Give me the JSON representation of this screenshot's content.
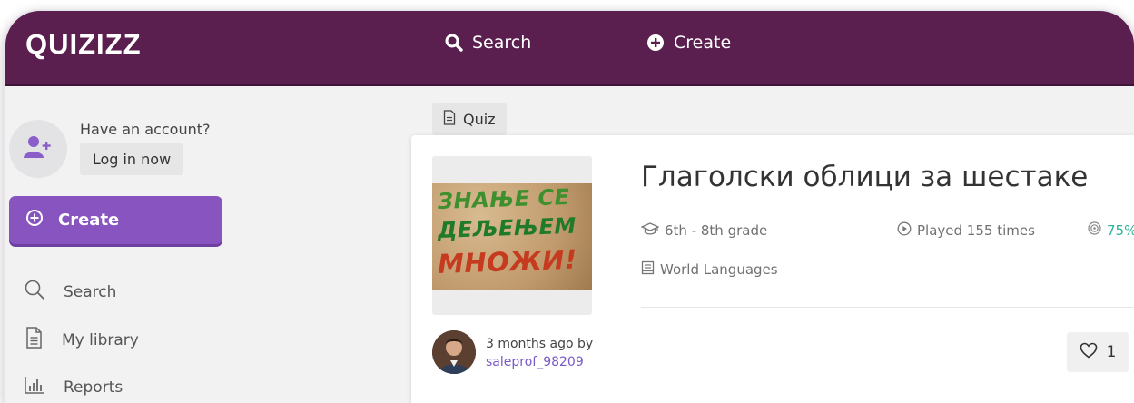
{
  "header": {
    "logo_text": "QUIZIZZ",
    "search_label": "Search",
    "create_label": "Create",
    "background_color": "#5a1f4e"
  },
  "sidebar": {
    "account_prompt": "Have an account?",
    "login_label": "Log in now",
    "create_label": "Create",
    "create_color": "#8854c0",
    "links": [
      {
        "label": "Search",
        "icon": "search-icon"
      },
      {
        "label": "My library",
        "icon": "document-icon"
      },
      {
        "label": "Reports",
        "icon": "bar-chart-icon"
      }
    ]
  },
  "quiz": {
    "tag_label": "Quiz",
    "title": "Глаголски облици за шестаке",
    "grade": "6th - 8th grade",
    "played": "Played 155 times",
    "accuracy": "75%",
    "subject": "World Languages",
    "thumbnail_text": [
      "ЗНАЊЕ СЕ",
      "ДЕЉЕЊЕМ",
      "МНОЖИ!"
    ],
    "author_time": "3 months ago by",
    "author_name": "saleprof_98209",
    "likes": "1"
  }
}
